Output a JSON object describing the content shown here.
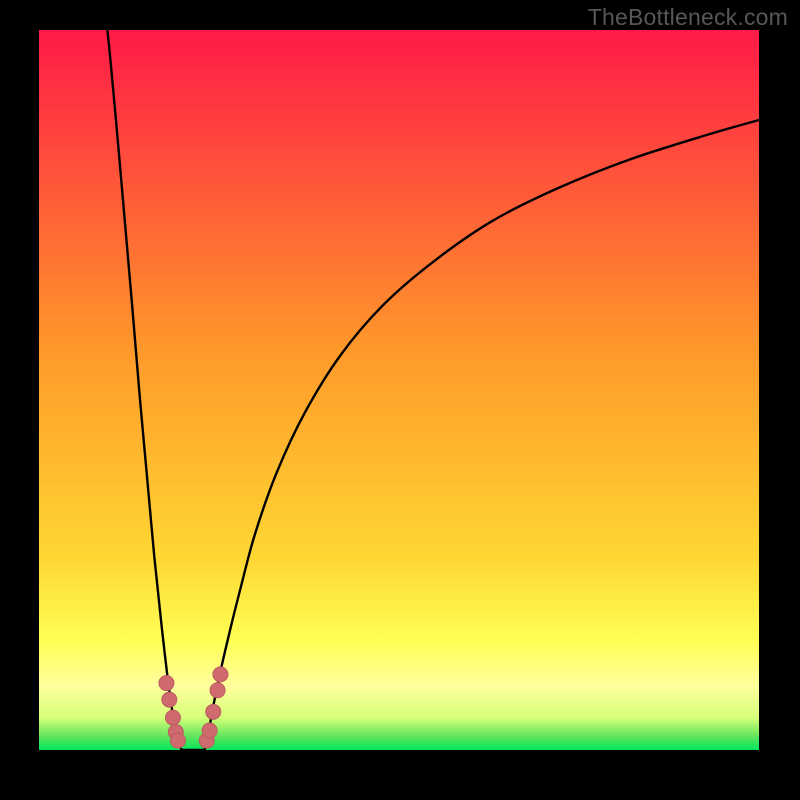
{
  "attribution": "TheBottleneck.com",
  "colors": {
    "frame_bg": "#000000",
    "grad_top": "#ff1a47",
    "grad_mid": "#ffcc33",
    "grad_yellow_pale": "#ffff9e",
    "grad_green": "#00e65c",
    "curve": "#000000",
    "marker_fill": "#cf6b6e",
    "marker_stroke": "#bb5a5e"
  },
  "chart_data": {
    "type": "line",
    "title": "",
    "xlabel": "",
    "ylabel": "",
    "xlim": [
      0,
      100
    ],
    "ylim": [
      0,
      100
    ],
    "legend": false,
    "grid": false,
    "note": "Two branches of a bottleneck-style curve with a sharp valley; bottom band is green, grading through yellow/orange to red at top. Markers cluster near the valley bottom.",
    "series": [
      {
        "name": "left_branch",
        "x": [
          9.5,
          10,
          11,
          12,
          13,
          14,
          15,
          16,
          17,
          18,
          19,
          19.8
        ],
        "y": [
          100,
          95,
          84,
          72.5,
          61,
          49,
          38,
          27,
          17.5,
          9,
          2.5,
          0
        ]
      },
      {
        "name": "right_branch",
        "x": [
          23,
          23.5,
          24,
          25,
          26.5,
          28,
          30,
          33,
          37,
          42,
          48,
          55,
          63,
          72,
          82,
          93,
          100
        ],
        "y": [
          0,
          2,
          5,
          10,
          16.5,
          22.5,
          30,
          38.5,
          47,
          55,
          62,
          68,
          73.5,
          78,
          82,
          85.5,
          87.5
        ]
      },
      {
        "name": "valley_floor",
        "x": [
          19.8,
          20.5,
          21.3,
          22.2,
          23
        ],
        "y": [
          0,
          0,
          0,
          0,
          0
        ]
      }
    ],
    "markers": [
      {
        "x": 17.7,
        "y": 9.3
      },
      {
        "x": 18.1,
        "y": 7.0
      },
      {
        "x": 18.6,
        "y": 4.5
      },
      {
        "x": 19.0,
        "y": 2.5
      },
      {
        "x": 19.3,
        "y": 1.3
      },
      {
        "x": 23.3,
        "y": 1.3
      },
      {
        "x": 23.7,
        "y": 2.7
      },
      {
        "x": 24.2,
        "y": 5.3
      },
      {
        "x": 24.8,
        "y": 8.3
      },
      {
        "x": 25.2,
        "y": 10.5
      }
    ]
  }
}
